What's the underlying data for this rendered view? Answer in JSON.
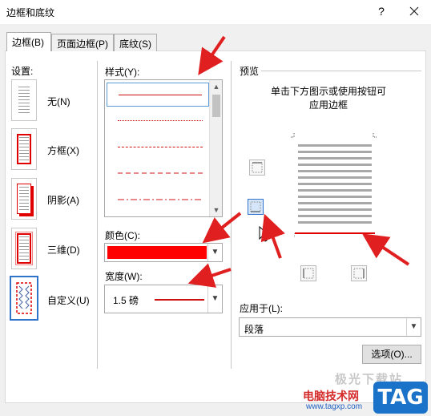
{
  "window": {
    "title": "边框和底纹",
    "help": "?"
  },
  "tabs": [
    {
      "label": "边框(B)",
      "active": true
    },
    {
      "label": "页面边框(P)",
      "active": false
    },
    {
      "label": "底纹(S)",
      "active": false
    }
  ],
  "settings": {
    "heading": "设置:",
    "presets": [
      {
        "label": "无(N)"
      },
      {
        "label": "方框(X)"
      },
      {
        "label": "阴影(A)"
      },
      {
        "label": "三维(D)"
      },
      {
        "label": "自定义(U)"
      }
    ]
  },
  "style": {
    "heading": "样式(Y):",
    "items": [
      "solid",
      "dotted",
      "dashed-small",
      "dashed",
      "dash-dot"
    ],
    "selected_index": 0,
    "line_color": "#d01010"
  },
  "color": {
    "heading": "颜色(C):",
    "value_hex": "#ff0000"
  },
  "width": {
    "heading": "宽度(W):",
    "value": "1.5 磅"
  },
  "preview": {
    "heading": "预览",
    "hint_line1": "单击下方图示或使用按钮可",
    "hint_line2": "应用边框",
    "applied_border": "bottom"
  },
  "apply_to": {
    "heading": "应用于(L):",
    "value": "段落"
  },
  "options_button": "选项(O)...",
  "watermark": {
    "top": "极光下载站",
    "site_name": "电脑技术网",
    "url": "www.tagxp.com",
    "logo": "TAG"
  },
  "colors": {
    "accent_red": "#e00000",
    "annotation_arrow": "#e02020",
    "selection_blue": "#2f74c8"
  }
}
